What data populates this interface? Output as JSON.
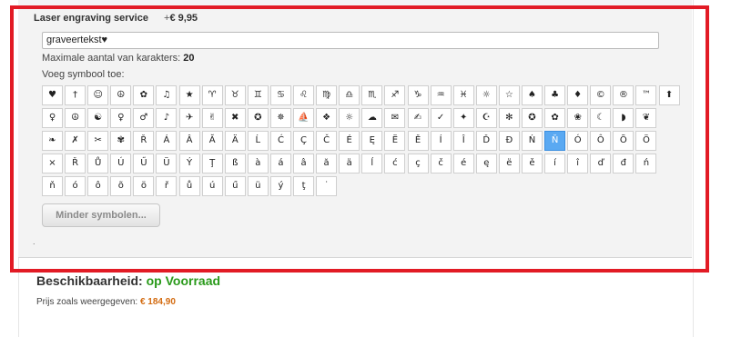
{
  "option": {
    "title": "Laser engraving service",
    "price_prefix": "+",
    "price": "€ 9,95",
    "input_value": "graveertekst♥",
    "max_chars_label": "Maximale aantal van karakters:",
    "max_chars_value": "20",
    "add_symbol_label": "Voeg symbool toe:",
    "less_symbols_label": "Minder symbolen...",
    "dot": "."
  },
  "symbols": {
    "rows": [
      [
        "♥",
        "†",
        "☺",
        "☮",
        "✿",
        "♫",
        "★",
        "♈",
        "♉",
        "♊",
        "♋",
        "♌",
        "♍",
        "♎",
        "♏",
        "♐",
        "♑",
        "♒",
        "♓",
        "☼",
        "☆",
        "♠",
        "♣",
        "♦",
        "©",
        "®",
        "™",
        "⬆"
      ],
      [
        "♀",
        "☮",
        "☯",
        "♀",
        "♂",
        "♪",
        "✈",
        "✌",
        "✖",
        "✪",
        "✵",
        "⛵",
        "❖",
        "☼",
        "☁",
        "✉",
        "✍",
        "✓",
        "✦",
        "☪",
        "✻",
        "✪",
        "✿",
        "❀",
        "☾",
        "◗",
        "❦"
      ],
      [
        "❧",
        "✗",
        "✂",
        "✾",
        "Ř",
        "Á",
        "Â",
        "Ă",
        "Ä",
        "Ĺ",
        "Ć",
        "Ç",
        "Č",
        "É",
        "Ę",
        "Ë",
        "Ě",
        "Í",
        "Î",
        "Ď",
        "Đ",
        "Ń",
        "Ň",
        "Ó",
        "Ô",
        "Õ",
        "Ö"
      ],
      [
        "×",
        "Ř",
        "Ů",
        "Ú",
        "Ű",
        "Ü",
        "Ý",
        "Ţ",
        "ß",
        "à",
        "á",
        "â",
        "ă",
        "ä",
        "ĺ",
        "ć",
        "ç",
        "č",
        "é",
        "ę",
        "ë",
        "ě",
        "í",
        "î",
        "ď",
        "đ",
        "ń"
      ],
      [
        "ň",
        "ó",
        "ô",
        "õ",
        "ö",
        "ř",
        "ů",
        "ú",
        "ű",
        "ü",
        "ý",
        "ţ",
        "˙"
      ]
    ],
    "selected": "Ň"
  },
  "availability": {
    "label": "Beschikbaarheid:",
    "status": "op Voorraad",
    "status_color": "#2a9a1b"
  },
  "price": {
    "label": "Prijs zoals weergegeven:",
    "value": "€ 184,90"
  },
  "colors": {
    "highlight_frame": "#e21b25",
    "selected_cell": "#5aa9f2",
    "price_value": "#d36b10"
  }
}
